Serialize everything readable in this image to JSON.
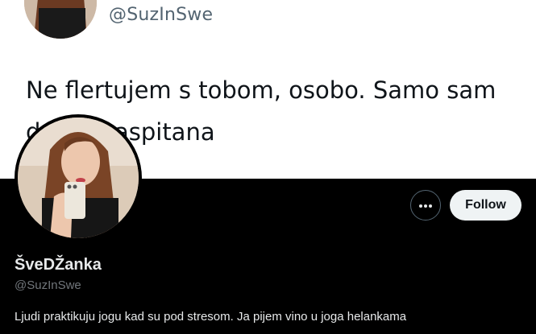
{
  "banner": {
    "handle": "@SuzInSwe",
    "tweet_text": "Ne flertujem s tobom, osobo. Samo sam dobro vaspitana"
  },
  "profile": {
    "display_name": "ŠveDŽanka",
    "handle": "@SuzInSwe",
    "bio": "Ljudi praktikuju jogu kad su pod stresom. Ja pijem vino u joga helankama"
  },
  "actions": {
    "more_icon": "more-horizontal-icon",
    "follow_label": "Follow"
  },
  "colors": {
    "background": "#000000",
    "banner_background": "#ffffff",
    "follow_button_bg": "#eff3f4",
    "secondary_text": "#71767b",
    "primary_text": "#e7e9ea"
  }
}
